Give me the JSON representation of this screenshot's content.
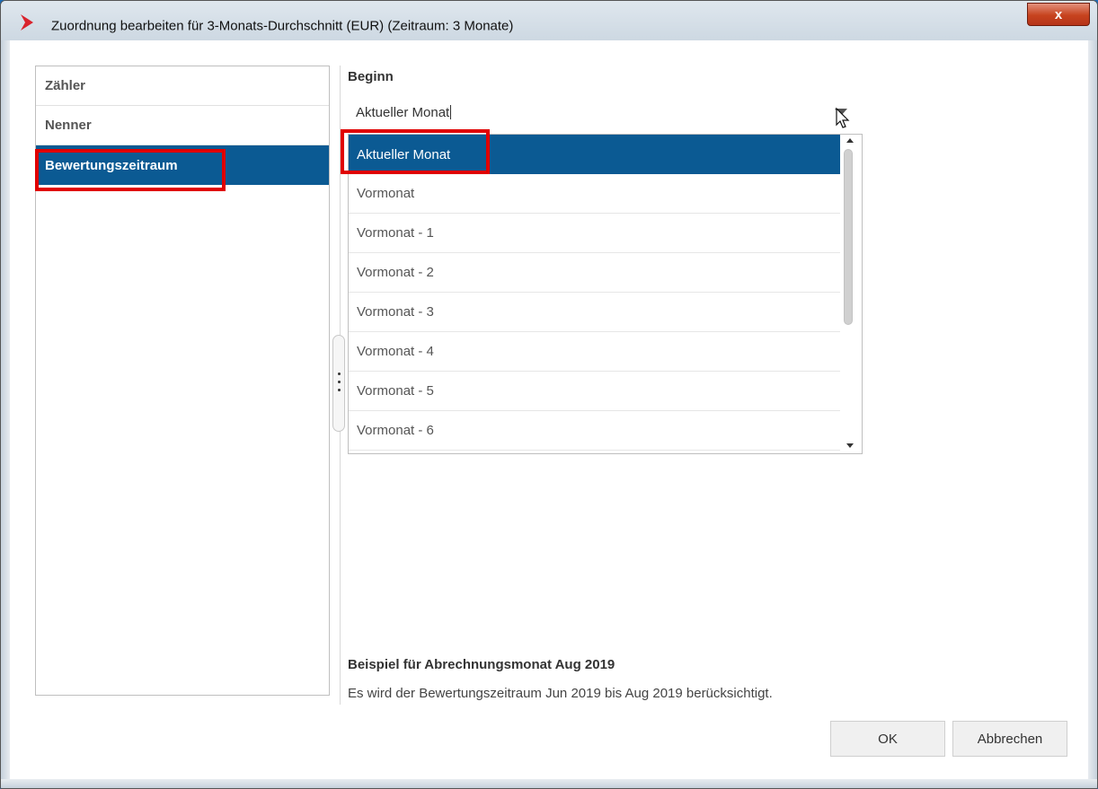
{
  "window": {
    "title": "Zuordnung bearbeiten für 3-Monats-Durchschnitt (EUR) (Zeitraum: 3 Monate)",
    "close_label": "x"
  },
  "sidebar": {
    "items": [
      {
        "label": "Zähler"
      },
      {
        "label": "Nenner"
      },
      {
        "label": "Bewertungszeitraum"
      }
    ],
    "selected": "Bewertungszeitraum"
  },
  "beginn": {
    "label": "Beginn",
    "value": "Aktueller Monat",
    "options": [
      "Aktueller Monat",
      "Vormonat",
      "Vormonat - 1",
      "Vormonat - 2",
      "Vormonat - 3",
      "Vormonat - 4",
      "Vormonat - 5",
      "Vormonat - 6"
    ]
  },
  "example": {
    "title": "Beispiel für Abrechnungsmonat Aug 2019",
    "text": "Es wird der Bewertungszeitraum Jun 2019 bis Aug 2019 berücksichtigt."
  },
  "buttons": {
    "ok": "OK",
    "cancel": "Abbrechen"
  },
  "colors": {
    "selection": "#0b5a93",
    "highlight": "#e00000",
    "brand": "#d9232d"
  }
}
